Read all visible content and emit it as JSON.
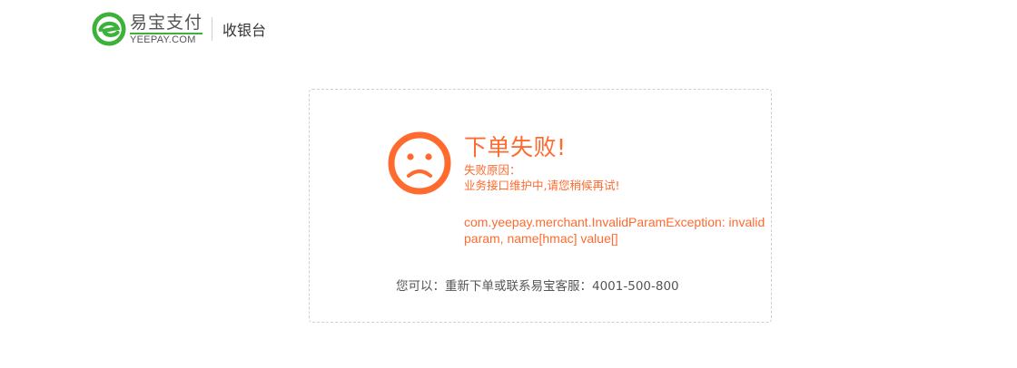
{
  "header": {
    "logo_cn": "易宝支付",
    "logo_en": "YEEPAY.COM",
    "title": "收银台"
  },
  "error": {
    "title": "下单失败!",
    "reason_label": "失败原因：",
    "reason": "业务接口维护中,请您稍候再试!",
    "detail": "com.yeepay.merchant.InvalidParamException: invalid param, name[hmac] value[]"
  },
  "help": {
    "text": "您可以：重新下单或联系易宝客服：4001-500-800"
  },
  "colors": {
    "brand_green": "#3cb23a",
    "error_orange": "#ff6a2f",
    "text_gray": "#555555"
  },
  "icons": {
    "logo": "yeepay-logo-icon",
    "status": "sad-face-icon"
  }
}
